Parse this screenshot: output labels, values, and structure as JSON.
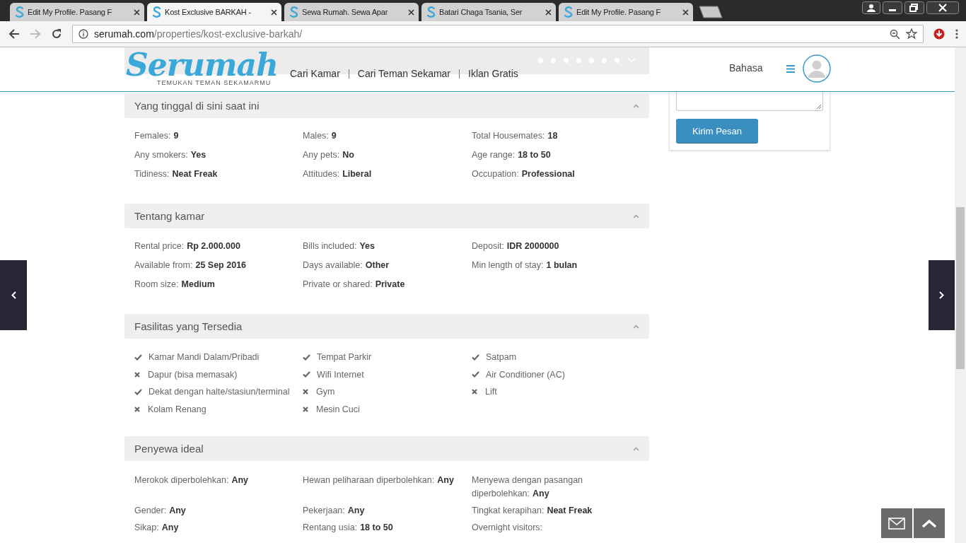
{
  "browser": {
    "tabs": [
      {
        "title": "Edit My Profile. Pasang F",
        "selected": false
      },
      {
        "title": "Kost Exclusive BARKAH -",
        "selected": true
      },
      {
        "title": "Sewa Rumah. Sewa Apar",
        "selected": false
      },
      {
        "title": "Batari Chaga Tsania, Ser",
        "selected": false
      },
      {
        "title": "Edit My Profile. Pasang F",
        "selected": false
      }
    ],
    "url_domain": "serumah.com",
    "url_path": "/properties/kost-exclusive-barkah/"
  },
  "header": {
    "logo": "Serumah",
    "tagline": "TEMUKAN TEMAN SEKAMARMU",
    "nav": [
      "Cari Kamar",
      "Cari Teman Sekamar",
      "Iklan Gratis"
    ],
    "language": "Bahasa",
    "slider_dots": [
      {
        "selected": false
      },
      {
        "selected": false
      },
      {
        "selected": false
      },
      {
        "selected": false
      },
      {
        "selected": false
      },
      {
        "selected": false
      },
      {
        "selected": false
      }
    ]
  },
  "sections": [
    {
      "title": "Yang tinggal di sini saat ini",
      "kind": "details",
      "items": [
        {
          "label": "Females:",
          "value": "9"
        },
        {
          "label": "Males:",
          "value": "9"
        },
        {
          "label": "Total Housemates:",
          "value": "18"
        },
        {
          "label": "Any smokers:",
          "value": "Yes"
        },
        {
          "label": "Any pets:",
          "value": "No"
        },
        {
          "label": "Age range:",
          "value": "18 to 50"
        },
        {
          "label": "Tidiness:",
          "value": "Neat Freak"
        },
        {
          "label": "Attitudes:",
          "value": "Liberal"
        },
        {
          "label": "Occupation:",
          "value": "Professional"
        }
      ]
    },
    {
      "title": "Tentang kamar",
      "kind": "details",
      "items": [
        {
          "label": "Rental price:",
          "value": "Rp 2.000.000"
        },
        {
          "label": "Bills included:",
          "value": "Yes"
        },
        {
          "label": "Deposit:",
          "value": "IDR 2000000"
        },
        {
          "label": "Available from:",
          "value": "25 Sep 2016"
        },
        {
          "label": "Days available:",
          "value": "Other"
        },
        {
          "label": "Min length of stay:",
          "value": "1 bulan"
        },
        {
          "label": "Room size:",
          "value": "Medium"
        },
        {
          "label": "Private or shared:",
          "value": "Private"
        }
      ]
    },
    {
      "title": "Fasilitas yang Tersedia",
      "kind": "facilities",
      "items": [
        {
          "label": "Kamar Mandi Dalam/Pribadi",
          "available": true
        },
        {
          "label": "Tempat Parkir",
          "available": true
        },
        {
          "label": "Satpam",
          "available": true
        },
        {
          "label": "Dapur (bisa memasak)",
          "available": false
        },
        {
          "label": "Wifi Internet",
          "available": true
        },
        {
          "label": "Air Conditioner (AC)",
          "available": true
        },
        {
          "label": "Dekat dengan halte/stasiun/terminal",
          "available": true
        },
        {
          "label": "Gym",
          "available": false
        },
        {
          "label": "Lift",
          "available": false
        },
        {
          "label": "Kolam Renang",
          "available": false
        },
        {
          "label": "Mesin Cuci",
          "available": false
        }
      ]
    },
    {
      "title": "Penyewa ideal",
      "kind": "details",
      "items": [
        {
          "label": "Merokok diperbolehkan:",
          "value": "Any"
        },
        {
          "label": "Hewan peliharaan diperbolehkan:",
          "value": "Any"
        },
        {
          "label": "Menyewa dengan pasangan diperbolehkan:",
          "value": "Any"
        },
        {
          "label": "Gender:",
          "value": "Any"
        },
        {
          "label": "Pekerjaan:",
          "value": "Any"
        },
        {
          "label": "Tingkat kerapihan:",
          "value": "Neat Freak"
        },
        {
          "label": "Sikap:",
          "value": "Any"
        },
        {
          "label": "Rentang usia:",
          "value": "18 to 50"
        },
        {
          "label": "Overnight visitors:"
        }
      ]
    }
  ],
  "contact": {
    "button": "Kirim Pesan"
  }
}
